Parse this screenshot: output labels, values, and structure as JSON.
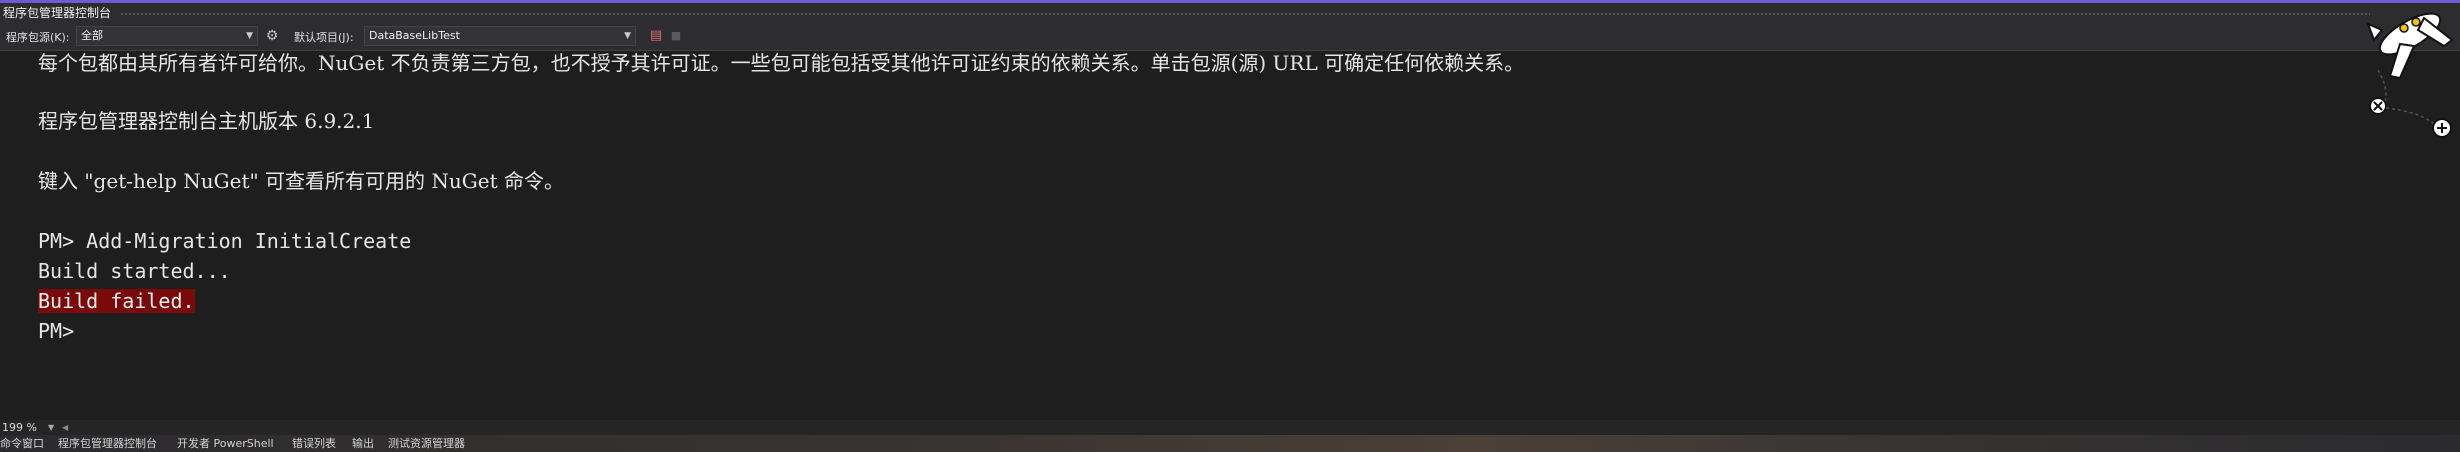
{
  "window": {
    "title": "程序包管理器控制台"
  },
  "toolbar": {
    "source_label": "程序包源(K):",
    "source_value": "全部",
    "default_project_label": "默认项目(J):",
    "default_project_value": "DataBaseLibTest"
  },
  "console": {
    "lines": [
      "每个包都由其所有者许可给你。NuGet 不负责第三方包，也不授予其许可证。一些包可能包括受其他许可证约束的依赖关系。单击包源(源) URL 可确定任何依赖关系。",
      "程序包管理器控制台主机版本 6.9.2.1",
      "键入 \"get-help NuGet\" 可查看所有可用的 NuGet 命令。",
      "PM> Add-Migration InitialCreate",
      "Build started...",
      "Build failed.",
      "PM>"
    ]
  },
  "zoom": {
    "value": "199 %"
  },
  "bottom_tabs": [
    "命令窗口",
    "程序包管理器控制台",
    "开发者 PowerShell",
    "错误列表",
    "输出",
    "测试资源管理器"
  ],
  "colors": {
    "accent": "#6b5bd6",
    "error_bg": "#7a0a0a",
    "background": "#1e1e1e"
  },
  "icons": [
    "settings-icon",
    "clear-console-icon",
    "stop-icon",
    "dropdown-arrow-icon",
    "airplane-mascot-icon"
  ]
}
